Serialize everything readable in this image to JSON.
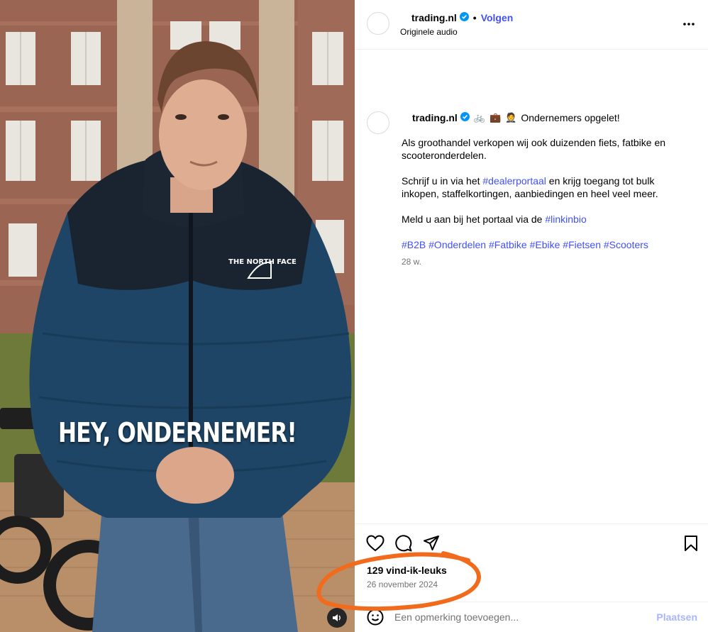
{
  "media": {
    "overlay_text": "HEY, ONDERNEMER!",
    "jacket_logo": "THE NORTH FACE",
    "mute_icon": "speaker-icon"
  },
  "header": {
    "username": "trading.nl",
    "separator": "•",
    "follow_label": "Volgen",
    "audio_label": "Originele audio",
    "more_icon": "more-horizontal-icon"
  },
  "caption": {
    "username": "trading.nl",
    "emojis": [
      "🚲",
      "💼",
      "🤵"
    ],
    "headline": "Ondernemers opgelet!",
    "paragraph1": "Als groothandel verkopen wij ook duizenden fiets, fatbike en scooteronderdelen.",
    "paragraph2_before": "Schrijf u in via het ",
    "paragraph2_tag": "#dealerportaal",
    "paragraph2_after": " en krijg toegang tot bulk inkopen, staffelkortingen, aanbiedingen en heel veel meer.",
    "paragraph3_before": "Meld u aan bij het portaal via de ",
    "paragraph3_tag": "#linkinbio",
    "hashtags": [
      "#B2B",
      "#Onderdelen",
      "#Fatbike",
      "#Ebike",
      "#Fietsen",
      "#Scooters"
    ],
    "time_ago": "28 w."
  },
  "actions": {
    "likes": "129 vind-ik-leuks",
    "date": "26 november 2024",
    "icons": [
      "heart-icon",
      "comment-icon",
      "share-icon",
      "bookmark-icon"
    ]
  },
  "comment": {
    "placeholder": "Een opmerking toevoegen...",
    "post_label": "Plaatsen"
  },
  "colors": {
    "link_blue": "#4150f7",
    "annotation_orange": "#f26b1d",
    "muted_text": "#737373"
  }
}
